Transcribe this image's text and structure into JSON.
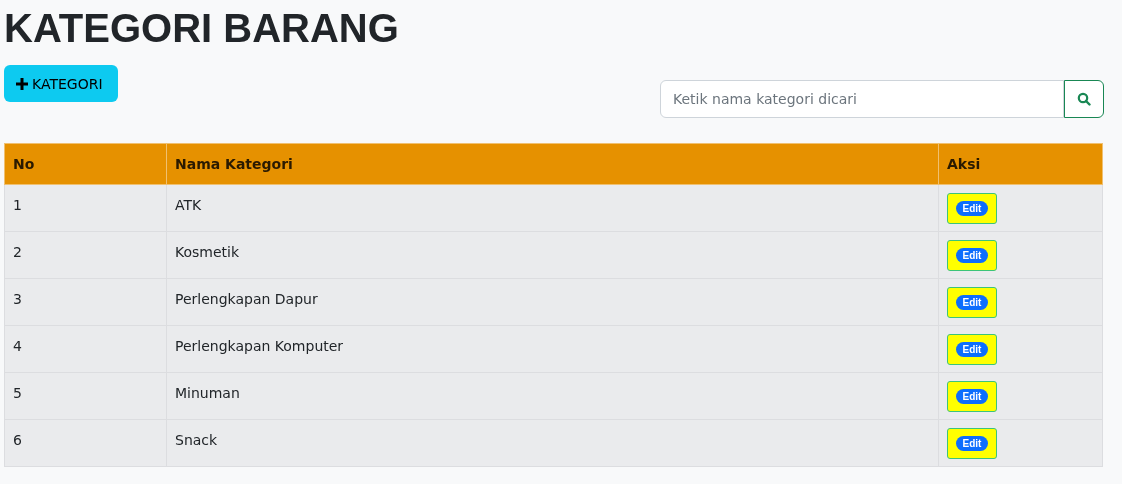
{
  "title": "KATEGORI BARANG",
  "add_button": {
    "label": "KATEGORI"
  },
  "search": {
    "placeholder": "Ketik nama kategori dicari"
  },
  "table": {
    "columns": [
      "No",
      "Nama Kategori",
      "Aksi"
    ],
    "rows": [
      {
        "no": "1",
        "name": "ATK",
        "action": "Edit"
      },
      {
        "no": "2",
        "name": "Kosmetik",
        "action": "Edit"
      },
      {
        "no": "3",
        "name": "Perlengkapan Dapur",
        "action": "Edit"
      },
      {
        "no": "4",
        "name": "Perlengkapan Komputer",
        "action": "Edit"
      },
      {
        "no": "5",
        "name": "Minuman",
        "action": "Edit"
      },
      {
        "no": "6",
        "name": "Snack",
        "action": "Edit"
      }
    ]
  }
}
